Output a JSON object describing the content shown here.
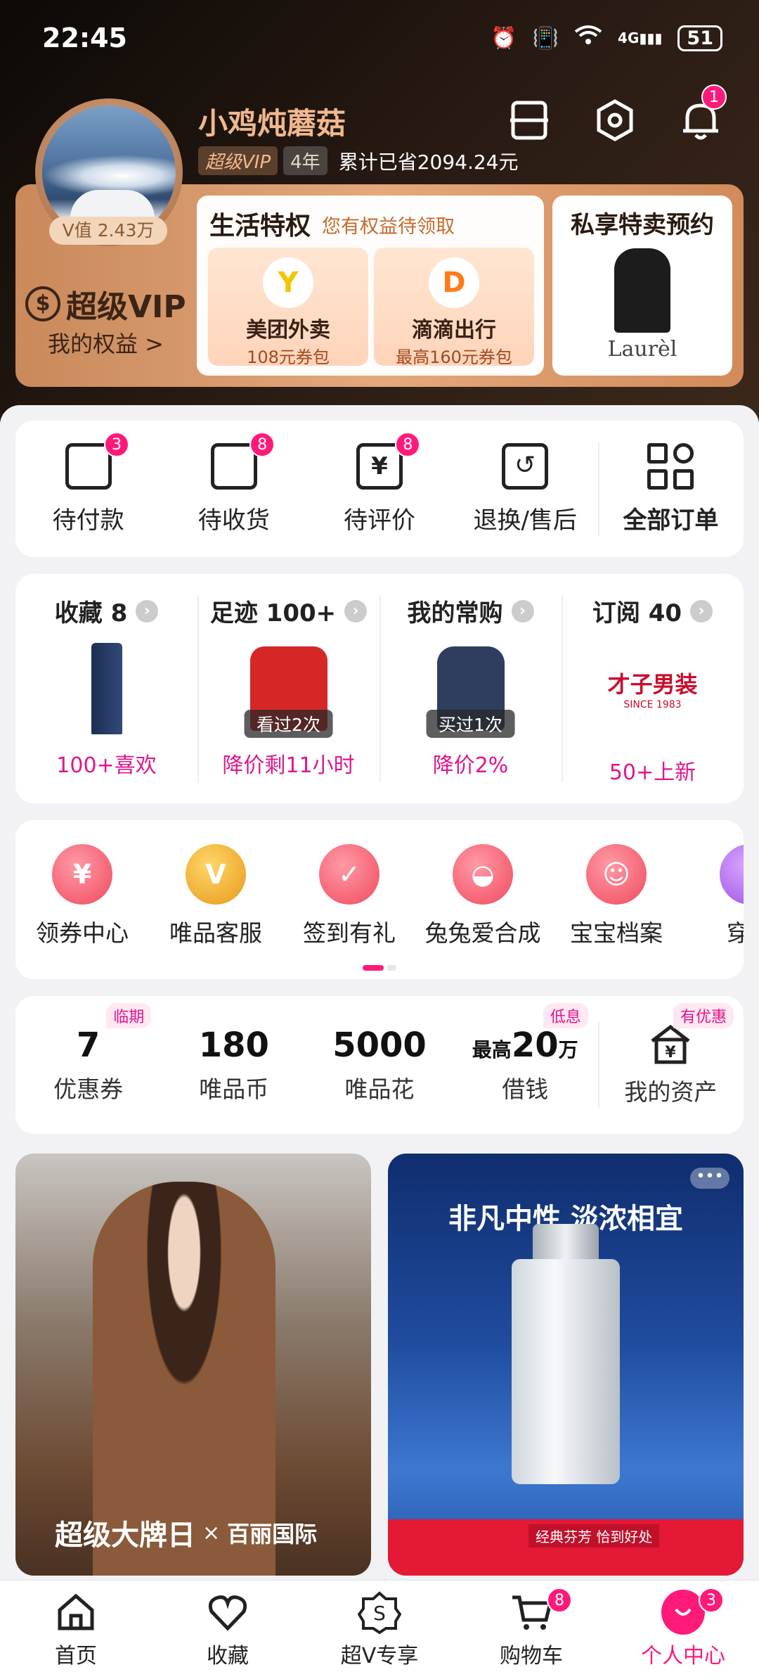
{
  "status": {
    "time": "22:45",
    "battery": "51",
    "signal": "4G"
  },
  "user": {
    "name": "小鸡炖蘑菇",
    "vip_tag": "超级VIP",
    "years": "4年",
    "saved": "累计已省2094.24元",
    "v_value": "V值 2.43万",
    "notif_count": "1"
  },
  "vip": {
    "logo": "超级VIP",
    "rights": "我的权益 >"
  },
  "privilege": {
    "title": "生活特权",
    "hint": "您有权益待领取",
    "coupons": [
      {
        "name": "美团外卖",
        "desc": "108元券包"
      },
      {
        "name": "滴滴出行",
        "desc": "最高160元券包"
      }
    ]
  },
  "private_sale": {
    "title": "私享特卖预约",
    "brand": "Laurèl"
  },
  "orders": [
    {
      "label": "待付款",
      "badge": "3"
    },
    {
      "label": "待收货",
      "badge": "8"
    },
    {
      "label": "待评价",
      "badge": "8"
    },
    {
      "label": "退换/售后",
      "badge": ""
    },
    {
      "label": "全部订单",
      "badge": ""
    }
  ],
  "fav": [
    {
      "head": "收藏 8",
      "tag": "",
      "foot": "100+喜欢"
    },
    {
      "head": "足迹 100+",
      "tag": "看过2次",
      "foot": "降价剩11小时"
    },
    {
      "head": "我的常购",
      "tag": "买过1次",
      "foot": "降价2%"
    },
    {
      "head": "订阅 40",
      "tag": "",
      "foot": "50+上新",
      "brand": "才子男装",
      "brand_sub": "SINCE 1983"
    }
  ],
  "services": [
    {
      "label": "领券中心"
    },
    {
      "label": "唯品客服"
    },
    {
      "label": "签到有礼"
    },
    {
      "label": "兔兔爱合成"
    },
    {
      "label": "宝宝档案"
    },
    {
      "label": "穿上"
    }
  ],
  "assets": [
    {
      "num": "7",
      "label": "优惠券",
      "tag": "临期"
    },
    {
      "num": "180",
      "label": "唯品币",
      "tag": ""
    },
    {
      "num": "5000",
      "label": "唯品花",
      "tag": ""
    },
    {
      "prefix": "最高",
      "num": "20",
      "suffix": "万",
      "label": "借钱",
      "tag": "低息"
    },
    {
      "label": "我的资产",
      "tag": "有优惠"
    }
  ],
  "ads": {
    "left": {
      "caption": "超级大牌日",
      "x": "×",
      "brand": "百丽国际"
    },
    "right": {
      "title": "非凡中性 淡浓相宜",
      "strip": "经典芬芳 恰到好处",
      "more": "•••"
    }
  },
  "nav": [
    {
      "label": "首页",
      "badge": ""
    },
    {
      "label": "收藏",
      "badge": ""
    },
    {
      "label": "超V专享",
      "badge": ""
    },
    {
      "label": "购物车",
      "badge": "8"
    },
    {
      "label": "个人中心",
      "badge": "3"
    }
  ]
}
